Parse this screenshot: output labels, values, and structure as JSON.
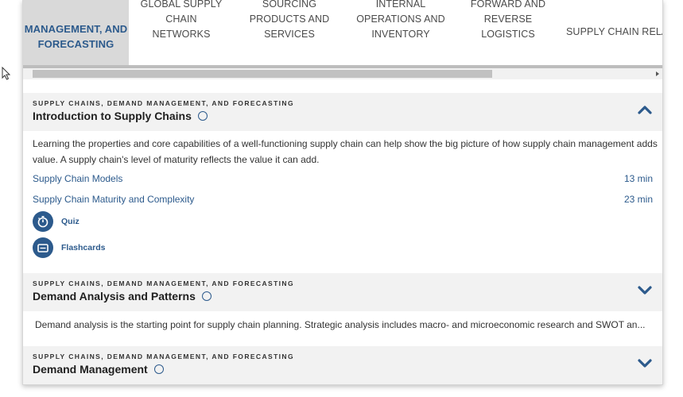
{
  "tabs": [
    {
      "label_line1": "MANAGEMENT, AND",
      "label_line2": "FORECASTING",
      "active": true
    },
    {
      "label_line1": "GLOBAL SUPPLY CHAIN",
      "label_line2": "NETWORKS",
      "active": false
    },
    {
      "label_line1": "SOURCING PRODUCTS AND",
      "label_line2": "SERVICES",
      "active": false
    },
    {
      "label_line1": "INTERNAL OPERATIONS AND",
      "label_line2": "INVENTORY",
      "active": false
    },
    {
      "label_line1": "FORWARD AND REVERSE",
      "label_line2": "LOGISTICS",
      "active": false
    },
    {
      "label_line1": "SUPPLY CHAIN RELATIONSHIP",
      "label_line2": "",
      "active": false
    }
  ],
  "sections": [
    {
      "eyebrow": "SUPPLY CHAINS, DEMAND MANAGEMENT, AND FORECASTING",
      "title": "Introduction to Supply Chains",
      "expanded": true,
      "description": "Learning the properties and core capabilities of a well-functioning supply chain can help show the big picture of how supply chain management adds value. A supply chain's level of maturity reflects the value it can add.",
      "lessons": [
        {
          "title": "Supply Chain Models",
          "duration": "13 min"
        },
        {
          "title": "Supply Chain Maturity and Complexity",
          "duration": "23 min"
        }
      ],
      "tools": [
        {
          "label": "Quiz",
          "icon": "stopwatch-icon"
        },
        {
          "label": "Flashcards",
          "icon": "card-icon"
        }
      ]
    },
    {
      "eyebrow": "SUPPLY CHAINS, DEMAND MANAGEMENT, AND FORECASTING",
      "title": "Demand Analysis and Patterns",
      "expanded": false,
      "description": "Demand analysis is the starting point for supply chain planning. Strategic analysis includes macro- and microeconomic research and SWOT an..."
    },
    {
      "eyebrow": "SUPPLY CHAINS, DEMAND MANAGEMENT, AND FORECASTING",
      "title": "Demand Management",
      "expanded": false
    }
  ],
  "colors": {
    "accent": "#2c5a8c",
    "header_bg": "#f2f2f2",
    "active_tab_bg": "#d9d9d9"
  }
}
